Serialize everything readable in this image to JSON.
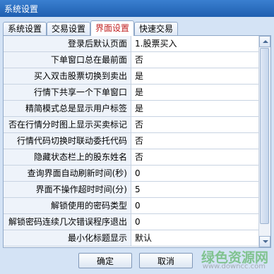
{
  "window": {
    "title": "系统设置"
  },
  "tabs": [
    {
      "label": "系统设置",
      "active": false
    },
    {
      "label": "交易设置",
      "active": false
    },
    {
      "label": "界面设置",
      "active": true
    },
    {
      "label": "快速交易",
      "active": false
    }
  ],
  "settings": [
    {
      "label": "登录后默认页面",
      "value": "1.股票买入"
    },
    {
      "label": "下单窗口总在最前面",
      "value": "否"
    },
    {
      "label": "买入双击股票切换到卖出",
      "value": "是"
    },
    {
      "label": "行情下共享一个下单窗口",
      "value": "是"
    },
    {
      "label": "精简模式总是显示用户标签",
      "value": "是"
    },
    {
      "label": "否在行情分时图上显示买卖标记",
      "value": "否"
    },
    {
      "label": "行情代码切换时联动委托代码",
      "value": "否"
    },
    {
      "label": "隐藏状态栏上的股东姓名",
      "value": "否"
    },
    {
      "label": "查询界面自动刷新时间(秒)",
      "value": "0"
    },
    {
      "label": "界面不操作超时时间(分)",
      "value": "5"
    },
    {
      "label": "解锁使用的密码类型",
      "value": "0"
    },
    {
      "label": "解锁密码连续几次错误程序退出",
      "value": "0"
    },
    {
      "label": "最小化标题显示",
      "value": "默认"
    }
  ],
  "buttons": {
    "ok": "确定",
    "cancel": "取消"
  },
  "watermark": {
    "text": "绿色资源网",
    "url": "www.downcc.com"
  }
}
